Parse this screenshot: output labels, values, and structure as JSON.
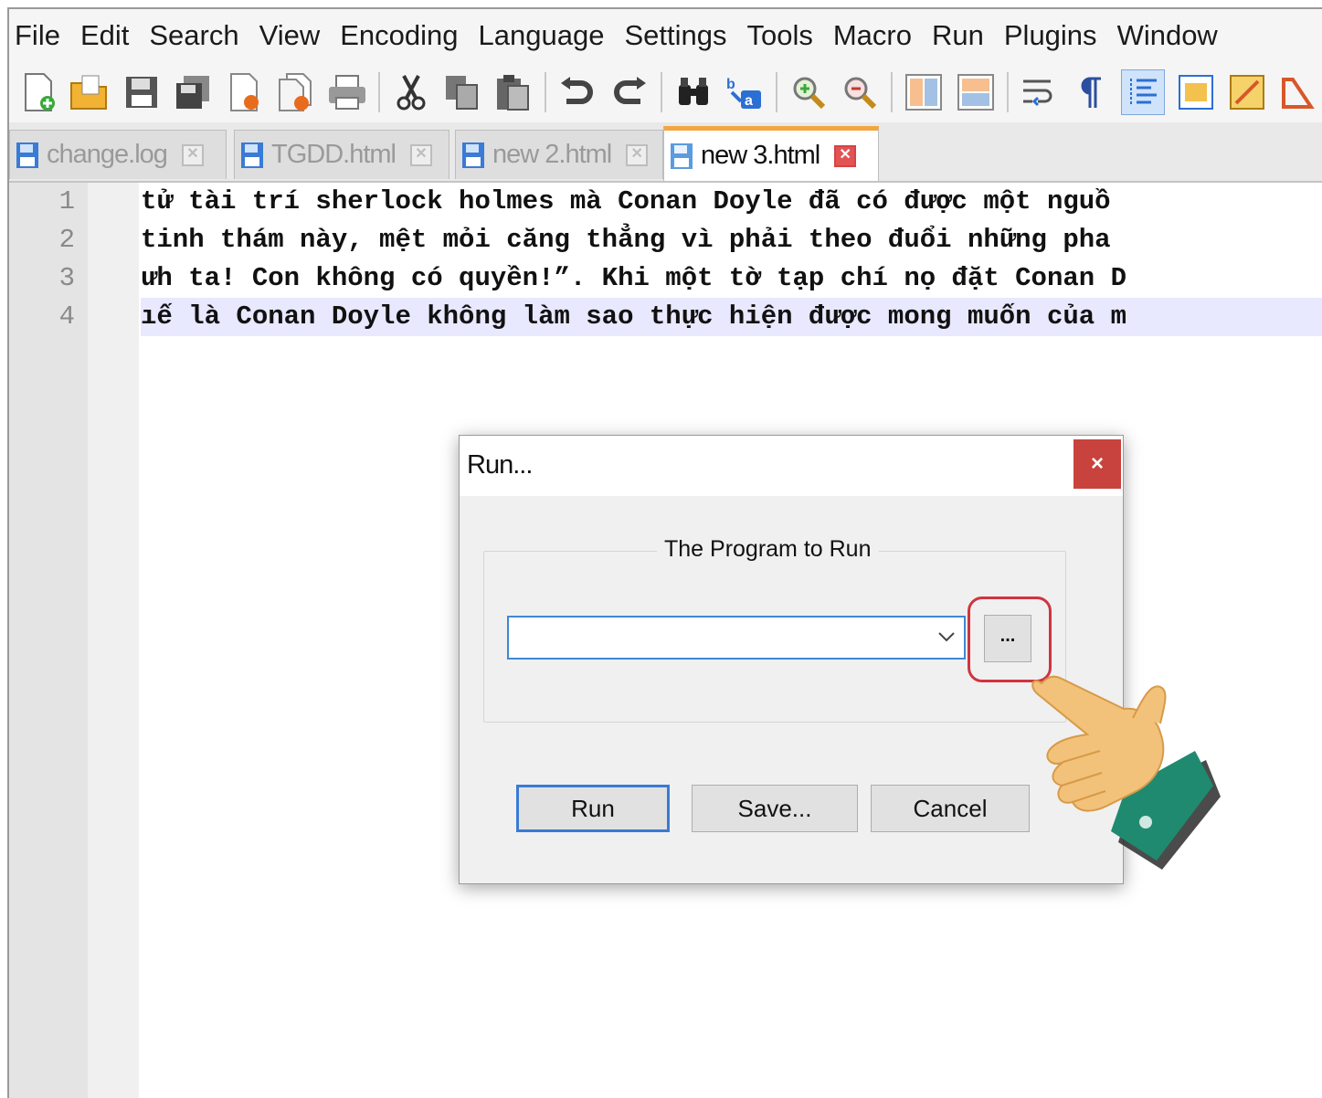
{
  "menubar": {
    "items": [
      {
        "label": "File"
      },
      {
        "label": "Edit"
      },
      {
        "label": "Search"
      },
      {
        "label": "View"
      },
      {
        "label": "Encoding"
      },
      {
        "label": "Language"
      },
      {
        "label": "Settings"
      },
      {
        "label": "Tools"
      },
      {
        "label": "Macro"
      },
      {
        "label": "Run"
      },
      {
        "label": "Plugins"
      },
      {
        "label": "Window"
      }
    ]
  },
  "toolbar": {
    "icons": [
      "new-file-icon",
      "open-file-icon",
      "save-icon",
      "save-all-icon",
      "close-icon",
      "close-all-icon",
      "print-icon",
      "cut-icon",
      "copy-icon",
      "paste-icon",
      "undo-icon",
      "redo-icon",
      "find-icon",
      "replace-icon",
      "zoom-in-icon",
      "zoom-out-icon",
      "sync-vertical-icon",
      "sync-horizontal-icon",
      "word-wrap-icon",
      "show-all-chars-icon",
      "indent-guide-icon",
      "doc-map-icon",
      "function-list-icon",
      "folder-workspace-icon"
    ]
  },
  "tabs": [
    {
      "label": "change.log",
      "active": false
    },
    {
      "label": "TGDD.html",
      "active": false
    },
    {
      "label": "new 2.html",
      "active": false
    },
    {
      "label": "new 3.html",
      "active": true
    }
  ],
  "editor": {
    "lines": [
      {
        "number": "1",
        "text": "tử tài trí sherlock holmes mà Conan Doyle đã có được một nguồ"
      },
      {
        "number": "2",
        "text": "tinh thám này, mệt mỏi căng thẳng vì phải theo đuổi những pha"
      },
      {
        "number": "3",
        "text": "ưh ta! Con không có quyền!”. Khi một tờ tạp chí nọ đặt Conan D"
      },
      {
        "number": "4",
        "text": "ıế là Conan Doyle không làm sao thực hiện được mong muốn của m"
      }
    ]
  },
  "dialog": {
    "title": "Run...",
    "close_glyph": "×",
    "group_label": "The Program to Run",
    "program_value": "",
    "browse_label": "...",
    "run_label": "Run",
    "save_label": "Save...",
    "cancel_label": "Cancel"
  },
  "colors": {
    "accent_tab": "#f2a640",
    "close_red": "#c8433d",
    "highlight_ring": "#d0343f",
    "current_line": "#e8e8ff",
    "focus_blue": "#3f87d6"
  }
}
